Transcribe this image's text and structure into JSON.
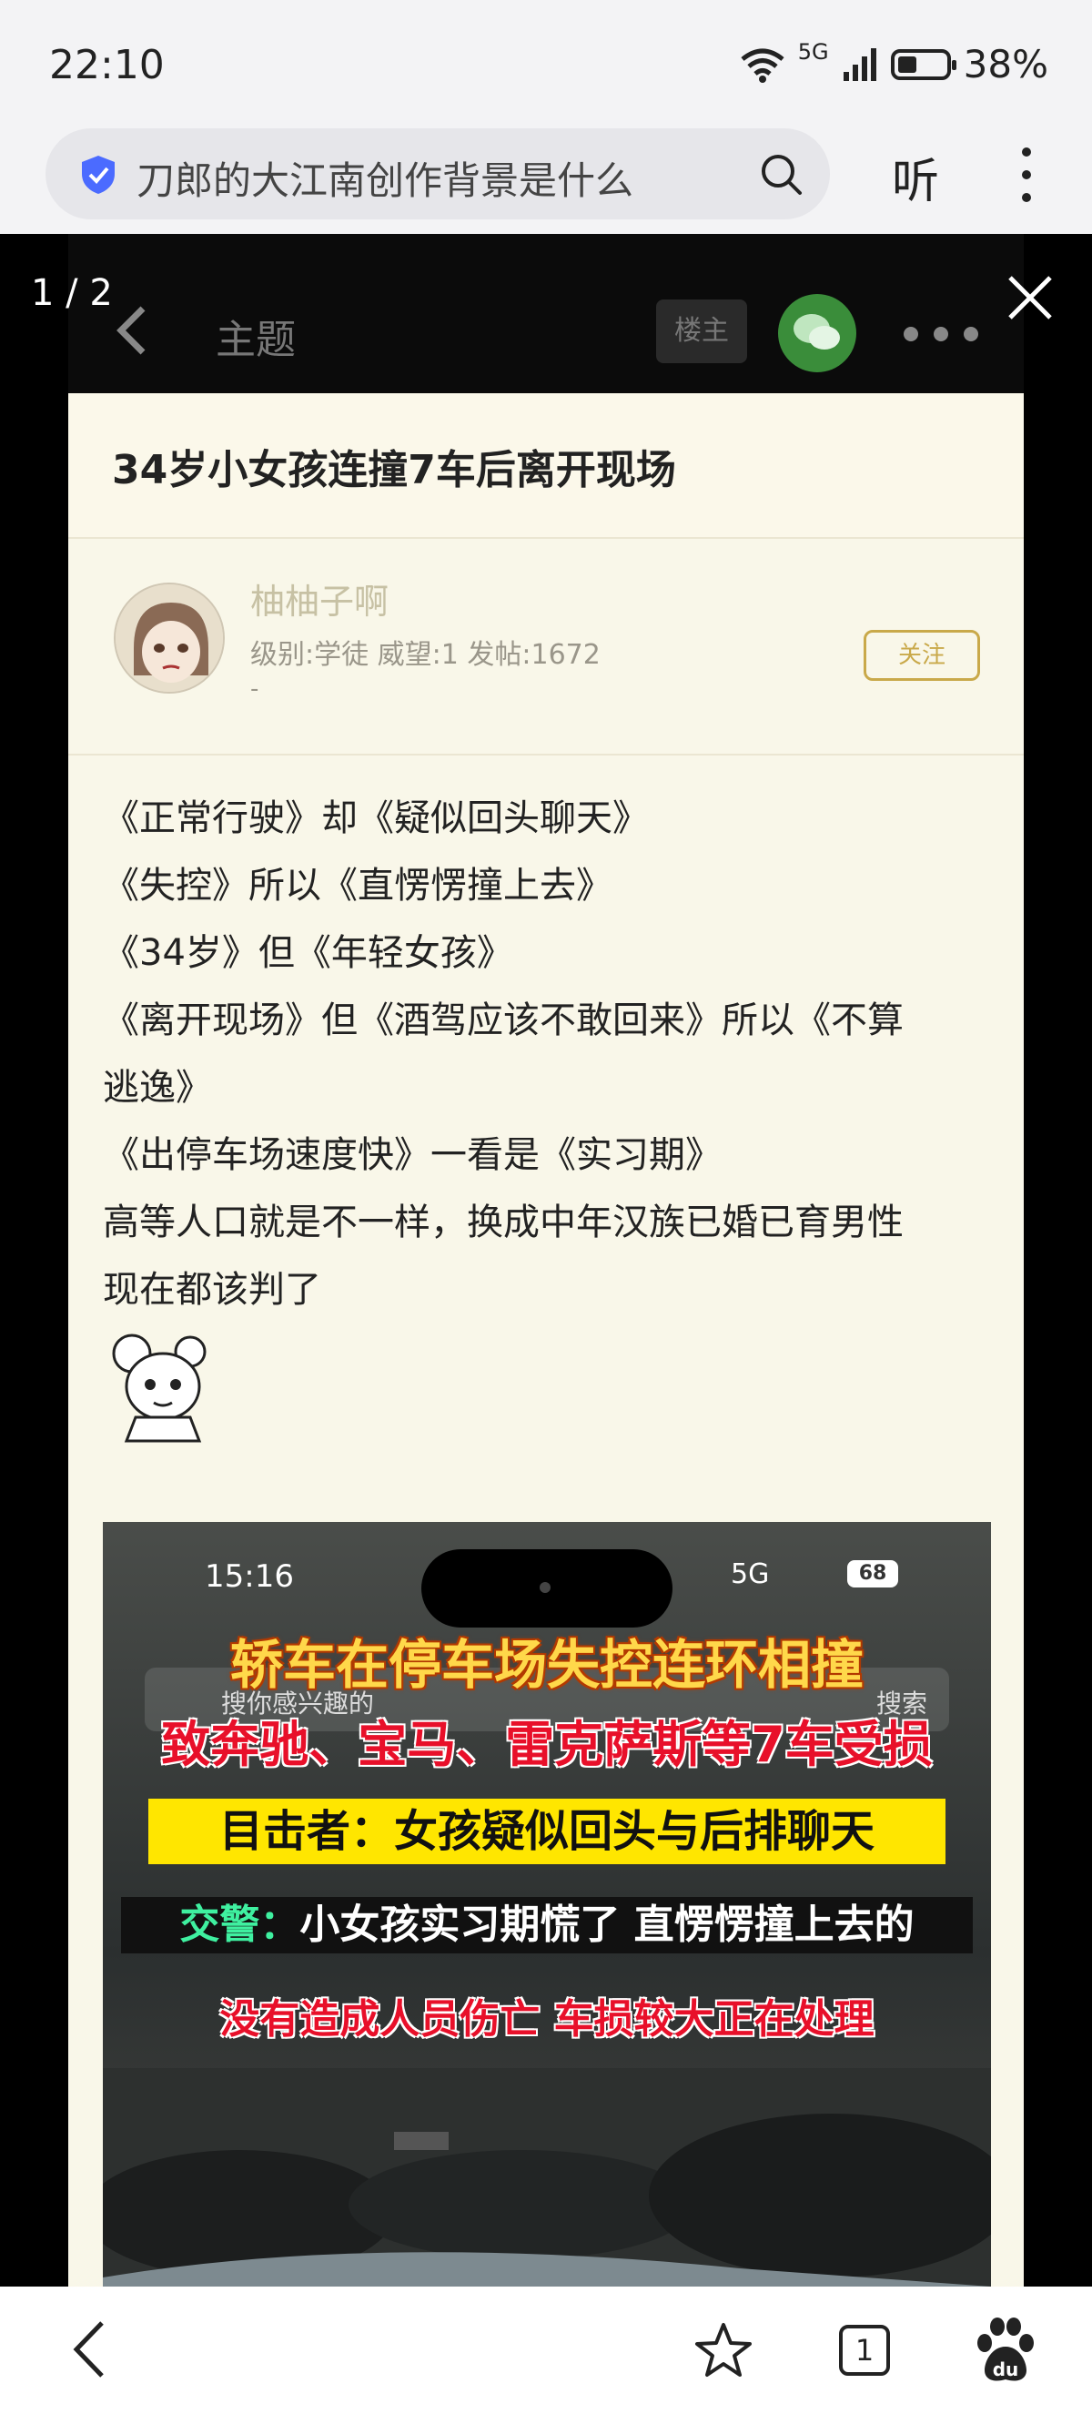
{
  "status_bar": {
    "time": "22:10",
    "network": "5G",
    "battery": "38%"
  },
  "browser": {
    "url_text": "刀郎的大江南创作背景是什么",
    "listen_label": "听"
  },
  "viewer": {
    "counter": "1 / 2"
  },
  "post": {
    "header_label": "主题",
    "louzhu_label": "楼主",
    "title": "34岁小女孩连撞7车后离开现场",
    "user": {
      "name": "柚柚子啊",
      "meta": "级别:学徒  威望:1  发帖:1672",
      "extra": "-"
    },
    "follow_label": "关注",
    "lines": [
      "《正常行驶》却《疑似回头聊天》",
      "《失控》所以《直愣愣撞上去》",
      "《34岁》但《年轻女孩》",
      "《离开现场》但《酒驾应该不敢回来》所以《不算",
      "逃逸》",
      "《出停车场速度快》一看是《实习期》",
      "高等人口就是不一样，换成中年汉族已婚已育男性",
      "现在都该判了"
    ]
  },
  "video": {
    "time": "15:16",
    "network": "5G",
    "battery": "68",
    "search_placeholder": "搜你感兴趣的",
    "search_button": "搜索",
    "caption1": "轿车在停车场失控连环相撞",
    "caption2": "致奔驰、宝马、雷克萨斯等7车受损",
    "caption3": "目击者：女孩疑似回头与后排聊天",
    "caption4_lead": "交警：",
    "caption4_rest": "小女孩实习期慌了 直愣愣撞上去的",
    "caption5": "没有造成人员伤亡 车损较大正在处理"
  },
  "bottom_nav": {
    "tab_count": "1"
  },
  "colors": {
    "post_bg": "#f9f7e9",
    "follow": "#c9a94a",
    "wechat": "#3a8d3a",
    "caption_red": "#e8102a",
    "caption_yellow": "#ffe600"
  }
}
